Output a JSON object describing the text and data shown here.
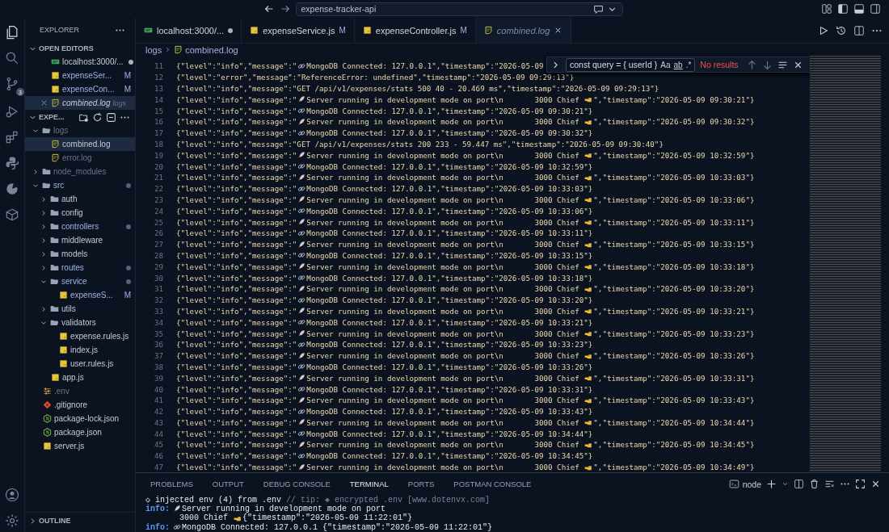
{
  "title_bar": {
    "search": "expense-tracker-api"
  },
  "activity_bar": {
    "scm_badge": "3"
  },
  "sidebar": {
    "title": "EXPLORER",
    "open_editors": {
      "label": "OPEN EDITORS",
      "expanded": true,
      "items": [
        {
          "name": "localhost:3000/...",
          "kind": "http",
          "selected": false,
          "dot": true,
          "italic": false,
          "closable": false
        },
        {
          "name": "expenseSer...",
          "kind": "js",
          "selected": false,
          "dot": false,
          "badge": "M",
          "italic": false,
          "closable": false
        },
        {
          "name": "expenseCon...",
          "kind": "js",
          "selected": false,
          "dot": false,
          "badge": "M",
          "italic": false,
          "closable": false
        },
        {
          "name": "combined.log",
          "kind": "log",
          "selected": true,
          "dot": false,
          "detail": "logs",
          "italic": true,
          "closable": true
        }
      ]
    },
    "project": {
      "label": "EXPE...",
      "expanded": true,
      "tree": [
        {
          "name": "logs",
          "kind": "folder",
          "expanded": true,
          "selected": false,
          "ignored": true,
          "dot": false,
          "children": [
            {
              "name": "combined.log",
              "kind": "log",
              "selected": true,
              "ignored": false,
              "dot": false
            },
            {
              "name": "error.log",
              "kind": "log",
              "selected": false,
              "ignored": true,
              "dot": false
            }
          ]
        },
        {
          "name": "node_modules",
          "kind": "folder",
          "expanded": false,
          "selected": false,
          "ignored": true,
          "dot": false
        },
        {
          "name": "src",
          "kind": "folder",
          "expanded": true,
          "selected": false,
          "ignored": false,
          "dot": true,
          "children": [
            {
              "name": "auth",
              "kind": "folder",
              "expanded": false,
              "selected": false,
              "ignored": false,
              "dot": false
            },
            {
              "name": "config",
              "kind": "folder",
              "expanded": false,
              "selected": false,
              "ignored": false,
              "dot": false
            },
            {
              "name": "controllers",
              "kind": "folder",
              "expanded": false,
              "selected": false,
              "ignored": false,
              "dot": true
            },
            {
              "name": "middleware",
              "kind": "folder",
              "expanded": false,
              "selected": false,
              "ignored": false,
              "dot": false
            },
            {
              "name": "models",
              "kind": "folder",
              "expanded": false,
              "selected": false,
              "ignored": false,
              "dot": false
            },
            {
              "name": "routes",
              "kind": "folder",
              "expanded": false,
              "selected": false,
              "ignored": false,
              "dot": true
            },
            {
              "name": "service",
              "kind": "folder",
              "expanded": true,
              "selected": false,
              "ignored": false,
              "dot": true,
              "children": [
                {
                  "name": "expenseS...",
                  "kind": "js",
                  "selected": false,
                  "ignored": false,
                  "dot": false,
                  "badge": "M"
                }
              ]
            },
            {
              "name": "utils",
              "kind": "folder",
              "expanded": false,
              "selected": false,
              "ignored": false,
              "dot": false
            },
            {
              "name": "validators",
              "kind": "folder",
              "expanded": true,
              "selected": false,
              "ignored": false,
              "dot": false,
              "children": [
                {
                  "name": "expense.rules.js",
                  "kind": "js",
                  "selected": false,
                  "ignored": false,
                  "dot": false
                },
                {
                  "name": "index.js",
                  "kind": "js",
                  "selected": false,
                  "ignored": false,
                  "dot": false
                },
                {
                  "name": "user.rules.js",
                  "kind": "js",
                  "selected": false,
                  "ignored": false,
                  "dot": false
                }
              ]
            },
            {
              "name": "app.js",
              "kind": "js",
              "selected": false,
              "ignored": false,
              "dot": false
            }
          ]
        },
        {
          "name": ".env",
          "kind": "env",
          "selected": false,
          "ignored": true,
          "dot": false
        },
        {
          "name": ".gitignore",
          "kind": "git",
          "selected": false,
          "ignored": false,
          "dot": false
        },
        {
          "name": "package-lock.json",
          "kind": "npm",
          "selected": false,
          "ignored": false,
          "dot": false
        },
        {
          "name": "package.json",
          "kind": "npm",
          "selected": false,
          "ignored": false,
          "dot": false
        },
        {
          "name": "server.js",
          "kind": "js",
          "selected": false,
          "ignored": false,
          "dot": false
        }
      ]
    },
    "outline": {
      "label": "OUTLINE",
      "expanded": false
    }
  },
  "tabs": [
    {
      "label": "localhost:3000/...",
      "kind": "http",
      "selected": false,
      "dot": true,
      "italic": false
    },
    {
      "label": "expenseService.js",
      "kind": "js",
      "selected": false,
      "dot": false,
      "badge": "M",
      "italic": false
    },
    {
      "label": "expenseController.js",
      "kind": "js",
      "selected": false,
      "dot": false,
      "badge": "M",
      "italic": false
    },
    {
      "label": "combined.log",
      "kind": "log",
      "selected": true,
      "dot": false,
      "italic": true
    }
  ],
  "breadcrumb": [
    "logs",
    "combined.log"
  ],
  "find_widget": {
    "query": "const query = { userId }",
    "match_case": "Aa",
    "whole_word": "ab",
    "regex": ".*",
    "result": "No results"
  },
  "editor_lines": [
    {
      "no": "11",
      "parts": [
        {
          "kind": "text",
          "text": "{\"level\":\"info\",\"message\":\""
        },
        {
          "kind": "link"
        },
        {
          "kind": "text",
          "text": "MongoDB Connected: 127.0.0.1\",\"timestamp\":\"2026-05-09"
        }
      ]
    },
    {
      "no": "12",
      "parts": [
        {
          "kind": "text",
          "text": "{\"level\":\"error\",\"message\":\"ReferenceError: undefined\",\"timestamp\":\"2026-05-09 09:29:13\"}"
        }
      ]
    },
    {
      "no": "13",
      "parts": [
        {
          "kind": "text",
          "text": "{\"level\":\"info\",\"message\":\"GET /api/v1/expenses/stats 500 40 - 20.469 ms\",\"timestamp\":\"2026-05-09 09:29:13\"}"
        }
      ]
    },
    {
      "no": "14",
      "parts": [
        {
          "kind": "text",
          "text": "{\"level\":\"info\",\"message\":\""
        },
        {
          "kind": "rocket"
        },
        {
          "kind": "text",
          "text": "Server running in development mode on port\\n       3000 Chief "
        },
        {
          "kind": "hand"
        },
        {
          "kind": "text",
          "text": "\",\"timestamp\":\"2026-05-09 09:30:21\"}"
        }
      ]
    },
    {
      "no": "15",
      "parts": [
        {
          "kind": "text",
          "text": "{\"level\":\"info\",\"message\":\""
        },
        {
          "kind": "link"
        },
        {
          "kind": "text",
          "text": "MongoDB Connected: 127.0.0.1\",\"timestamp\":\"2026-05-09 09:30:21\"}"
        }
      ]
    },
    {
      "no": "16",
      "parts": [
        {
          "kind": "text",
          "text": "{\"level\":\"info\",\"message\":\""
        },
        {
          "kind": "rocket"
        },
        {
          "kind": "text",
          "text": "Server running in development mode on port\\n       3000 Chief "
        },
        {
          "kind": "hand"
        },
        {
          "kind": "text",
          "text": "\",\"timestamp\":\"2026-05-09 09:30:32\"}"
        }
      ]
    },
    {
      "no": "17",
      "parts": [
        {
          "kind": "text",
          "text": "{\"level\":\"info\",\"message\":\""
        },
        {
          "kind": "link"
        },
        {
          "kind": "text",
          "text": "MongoDB Connected: 127.0.0.1\",\"timestamp\":\"2026-05-09 09:30:32\"}"
        }
      ]
    },
    {
      "no": "18",
      "parts": [
        {
          "kind": "text",
          "text": "{\"level\":\"info\",\"message\":\"GET /api/v1/expenses/stats 200 233 - 59.447 ms\",\"timestamp\":\"2026-05-09 09:30:40\"}"
        }
      ]
    },
    {
      "no": "19",
      "parts": [
        {
          "kind": "text",
          "text": "{\"level\":\"info\",\"message\":\""
        },
        {
          "kind": "rocket"
        },
        {
          "kind": "text",
          "text": "Server running in development mode on port\\n       3000 Chief "
        },
        {
          "kind": "hand"
        },
        {
          "kind": "text",
          "text": "\",\"timestamp\":\"2026-05-09 10:32:59\"}"
        }
      ]
    },
    {
      "no": "20",
      "parts": [
        {
          "kind": "text",
          "text": "{\"level\":\"info\",\"message\":\""
        },
        {
          "kind": "link"
        },
        {
          "kind": "text",
          "text": "MongoDB Connected: 127.0.0.1\",\"timestamp\":\"2026-05-09 10:32:59\"}"
        }
      ]
    },
    {
      "no": "21",
      "parts": [
        {
          "kind": "text",
          "text": "{\"level\":\"info\",\"message\":\""
        },
        {
          "kind": "rocket"
        },
        {
          "kind": "text",
          "text": "Server running in development mode on port\\n       3000 Chief "
        },
        {
          "kind": "hand"
        },
        {
          "kind": "text",
          "text": "\",\"timestamp\":\"2026-05-09 10:33:03\"}"
        }
      ]
    },
    {
      "no": "22",
      "parts": [
        {
          "kind": "text",
          "text": "{\"level\":\"info\",\"message\":\""
        },
        {
          "kind": "link"
        },
        {
          "kind": "text",
          "text": "MongoDB Connected: 127.0.0.1\",\"timestamp\":\"2026-05-09 10:33:03\"}"
        }
      ]
    },
    {
      "no": "23",
      "parts": [
        {
          "kind": "text",
          "text": "{\"level\":\"info\",\"message\":\""
        },
        {
          "kind": "rocket"
        },
        {
          "kind": "text",
          "text": "Server running in development mode on port\\n       3000 Chief "
        },
        {
          "kind": "hand"
        },
        {
          "kind": "text",
          "text": "\",\"timestamp\":\"2026-05-09 10:33:06\"}"
        }
      ]
    },
    {
      "no": "24",
      "parts": [
        {
          "kind": "text",
          "text": "{\"level\":\"info\",\"message\":\""
        },
        {
          "kind": "link"
        },
        {
          "kind": "text",
          "text": "MongoDB Connected: 127.0.0.1\",\"timestamp\":\"2026-05-09 10:33:06\"}"
        }
      ]
    },
    {
      "no": "25",
      "parts": [
        {
          "kind": "text",
          "text": "{\"level\":\"info\",\"message\":\""
        },
        {
          "kind": "rocket"
        },
        {
          "kind": "text",
          "text": "Server running in development mode on port\\n       3000 Chief "
        },
        {
          "kind": "hand"
        },
        {
          "kind": "text",
          "text": "\",\"timestamp\":\"2026-05-09 10:33:11\"}"
        }
      ]
    },
    {
      "no": "26",
      "parts": [
        {
          "kind": "text",
          "text": "{\"level\":\"info\",\"message\":\""
        },
        {
          "kind": "link"
        },
        {
          "kind": "text",
          "text": "MongoDB Connected: 127.0.0.1\",\"timestamp\":\"2026-05-09 10:33:11\"}"
        }
      ]
    },
    {
      "no": "27",
      "parts": [
        {
          "kind": "text",
          "text": "{\"level\":\"info\",\"message\":\""
        },
        {
          "kind": "rocket"
        },
        {
          "kind": "text",
          "text": "Server running in development mode on port\\n       3000 Chief "
        },
        {
          "kind": "hand"
        },
        {
          "kind": "text",
          "text": "\",\"timestamp\":\"2026-05-09 10:33:15\"}"
        }
      ]
    },
    {
      "no": "28",
      "parts": [
        {
          "kind": "text",
          "text": "{\"level\":\"info\",\"message\":\""
        },
        {
          "kind": "link"
        },
        {
          "kind": "text",
          "text": "MongoDB Connected: 127.0.0.1\",\"timestamp\":\"2026-05-09 10:33:15\"}"
        }
      ]
    },
    {
      "no": "29",
      "parts": [
        {
          "kind": "text",
          "text": "{\"level\":\"info\",\"message\":\""
        },
        {
          "kind": "rocket"
        },
        {
          "kind": "text",
          "text": "Server running in development mode on port\\n       3000 Chief "
        },
        {
          "kind": "hand"
        },
        {
          "kind": "text",
          "text": "\",\"timestamp\":\"2026-05-09 10:33:18\"}"
        }
      ]
    },
    {
      "no": "30",
      "parts": [
        {
          "kind": "text",
          "text": "{\"level\":\"info\",\"message\":\""
        },
        {
          "kind": "link"
        },
        {
          "kind": "text",
          "text": "MongoDB Connected: 127.0.0.1\",\"timestamp\":\"2026-05-09 10:33:18\"}"
        }
      ]
    },
    {
      "no": "31",
      "parts": [
        {
          "kind": "text",
          "text": "{\"level\":\"info\",\"message\":\""
        },
        {
          "kind": "rocket"
        },
        {
          "kind": "text",
          "text": "Server running in development mode on port\\n       3000 Chief "
        },
        {
          "kind": "hand"
        },
        {
          "kind": "text",
          "text": "\",\"timestamp\":\"2026-05-09 10:33:20\"}"
        }
      ]
    },
    {
      "no": "32",
      "parts": [
        {
          "kind": "text",
          "text": "{\"level\":\"info\",\"message\":\""
        },
        {
          "kind": "link"
        },
        {
          "kind": "text",
          "text": "MongoDB Connected: 127.0.0.1\",\"timestamp\":\"2026-05-09 10:33:20\"}"
        }
      ]
    },
    {
      "no": "33",
      "parts": [
        {
          "kind": "text",
          "text": "{\"level\":\"info\",\"message\":\""
        },
        {
          "kind": "rocket"
        },
        {
          "kind": "text",
          "text": "Server running in development mode on port\\n       3000 Chief "
        },
        {
          "kind": "hand"
        },
        {
          "kind": "text",
          "text": "\",\"timestamp\":\"2026-05-09 10:33:21\"}"
        }
      ]
    },
    {
      "no": "34",
      "parts": [
        {
          "kind": "text",
          "text": "{\"level\":\"info\",\"message\":\""
        },
        {
          "kind": "link"
        },
        {
          "kind": "text",
          "text": "MongoDB Connected: 127.0.0.1\",\"timestamp\":\"2026-05-09 10:33:21\"}"
        }
      ]
    },
    {
      "no": "35",
      "parts": [
        {
          "kind": "text",
          "text": "{\"level\":\"info\",\"message\":\""
        },
        {
          "kind": "rocket"
        },
        {
          "kind": "text",
          "text": "Server running in development mode on port\\n       3000 Chief "
        },
        {
          "kind": "hand"
        },
        {
          "kind": "text",
          "text": "\",\"timestamp\":\"2026-05-09 10:33:23\"}"
        }
      ]
    },
    {
      "no": "36",
      "parts": [
        {
          "kind": "text",
          "text": "{\"level\":\"info\",\"message\":\""
        },
        {
          "kind": "link"
        },
        {
          "kind": "text",
          "text": "MongoDB Connected: 127.0.0.1\",\"timestamp\":\"2026-05-09 10:33:23\"}"
        }
      ]
    },
    {
      "no": "37",
      "parts": [
        {
          "kind": "text",
          "text": "{\"level\":\"info\",\"message\":\""
        },
        {
          "kind": "rocket"
        },
        {
          "kind": "text",
          "text": "Server running in development mode on port\\n       3000 Chief "
        },
        {
          "kind": "hand"
        },
        {
          "kind": "text",
          "text": "\",\"timestamp\":\"2026-05-09 10:33:26\"}"
        }
      ]
    },
    {
      "no": "38",
      "parts": [
        {
          "kind": "text",
          "text": "{\"level\":\"info\",\"message\":\""
        },
        {
          "kind": "link"
        },
        {
          "kind": "text",
          "text": "MongoDB Connected: 127.0.0.1\",\"timestamp\":\"2026-05-09 10:33:26\"}"
        }
      ]
    },
    {
      "no": "39",
      "parts": [
        {
          "kind": "text",
          "text": "{\"level\":\"info\",\"message\":\""
        },
        {
          "kind": "rocket"
        },
        {
          "kind": "text",
          "text": "Server running in development mode on port\\n       3000 Chief "
        },
        {
          "kind": "hand"
        },
        {
          "kind": "text",
          "text": "\",\"timestamp\":\"2026-05-09 10:33:31\"}"
        }
      ]
    },
    {
      "no": "40",
      "parts": [
        {
          "kind": "text",
          "text": "{\"level\":\"info\",\"message\":\""
        },
        {
          "kind": "link"
        },
        {
          "kind": "text",
          "text": "MongoDB Connected: 127.0.0.1\",\"timestamp\":\"2026-05-09 10:33:31\"}"
        }
      ]
    },
    {
      "no": "41",
      "parts": [
        {
          "kind": "text",
          "text": "{\"level\":\"info\",\"message\":\""
        },
        {
          "kind": "rocket"
        },
        {
          "kind": "text",
          "text": "Server running in development mode on port\\n       3000 Chief "
        },
        {
          "kind": "hand"
        },
        {
          "kind": "text",
          "text": "\",\"timestamp\":\"2026-05-09 10:33:43\"}"
        }
      ]
    },
    {
      "no": "42",
      "parts": [
        {
          "kind": "text",
          "text": "{\"level\":\"info\",\"message\":\""
        },
        {
          "kind": "link"
        },
        {
          "kind": "text",
          "text": "MongoDB Connected: 127.0.0.1\",\"timestamp\":\"2026-05-09 10:33:43\"}"
        }
      ]
    },
    {
      "no": "43",
      "parts": [
        {
          "kind": "text",
          "text": "{\"level\":\"info\",\"message\":\""
        },
        {
          "kind": "rocket"
        },
        {
          "kind": "text",
          "text": "Server running in development mode on port\\n       3000 Chief "
        },
        {
          "kind": "hand"
        },
        {
          "kind": "text",
          "text": "\",\"timestamp\":\"2026-05-09 10:34:44\"}"
        }
      ]
    },
    {
      "no": "44",
      "parts": [
        {
          "kind": "text",
          "text": "{\"level\":\"info\",\"message\":\""
        },
        {
          "kind": "link"
        },
        {
          "kind": "text",
          "text": "MongoDB Connected: 127.0.0.1\",\"timestamp\":\"2026-05-09 10:34:44\"}"
        }
      ]
    },
    {
      "no": "45",
      "parts": [
        {
          "kind": "text",
          "text": "{\"level\":\"info\",\"message\":\""
        },
        {
          "kind": "rocket"
        },
        {
          "kind": "text",
          "text": "Server running in development mode on port\\n       3000 Chief "
        },
        {
          "kind": "hand"
        },
        {
          "kind": "text",
          "text": "\",\"timestamp\":\"2026-05-09 10:34:45\"}"
        }
      ]
    },
    {
      "no": "46",
      "parts": [
        {
          "kind": "text",
          "text": "{\"level\":\"info\",\"message\":\""
        },
        {
          "kind": "link"
        },
        {
          "kind": "text",
          "text": "MongoDB Connected: 127.0.0.1\",\"timestamp\":\"2026-05-09 10:34:45\"}"
        }
      ]
    },
    {
      "no": "47",
      "parts": [
        {
          "kind": "text",
          "text": "{\"level\":\"info\",\"message\":\""
        },
        {
          "kind": "rocket"
        },
        {
          "kind": "text",
          "text": "Server running in development mode on port\\n       3000 Chief "
        },
        {
          "kind": "hand"
        },
        {
          "kind": "text",
          "text": "\",\"timestamp\":\"2026-05-09 10:34:49\"}"
        }
      ]
    }
  ],
  "panel": {
    "tabs": [
      {
        "label": "PROBLEMS",
        "selected": false
      },
      {
        "label": "OUTPUT",
        "selected": false
      },
      {
        "label": "DEBUG CONSOLE",
        "selected": false
      },
      {
        "label": "TERMINAL",
        "selected": true
      },
      {
        "label": "PORTS",
        "selected": false
      },
      {
        "label": "POSTMAN CONSOLE",
        "selected": false
      }
    ],
    "terminal_name": "node",
    "terminal_lines": [
      [
        {
          "kind": "text",
          "text": "◇ injected env (4) from .env"
        },
        {
          "kind": "dim",
          "text": " // tip: ◈ encrypted .env [www.dotenvx.com]"
        }
      ],
      [
        {
          "kind": "label",
          "text": "info:"
        },
        {
          "kind": "rocket"
        },
        {
          "kind": "text",
          "text": "Server running in development mode on port"
        }
      ],
      [
        {
          "kind": "text",
          "text": "       3000 Chief "
        },
        {
          "kind": "hand"
        },
        {
          "kind": "text",
          "text": "{\"timestamp\":\"2026-05-09 11:22:01\"}"
        }
      ],
      [
        {
          "kind": "label",
          "text": "info:"
        },
        {
          "kind": "link"
        },
        {
          "kind": "text",
          "text": "MongoDB Connected: 127.0.0.1 {\"timestamp\":\"2026-05-09 11:22:01\"}"
        }
      ]
    ]
  }
}
